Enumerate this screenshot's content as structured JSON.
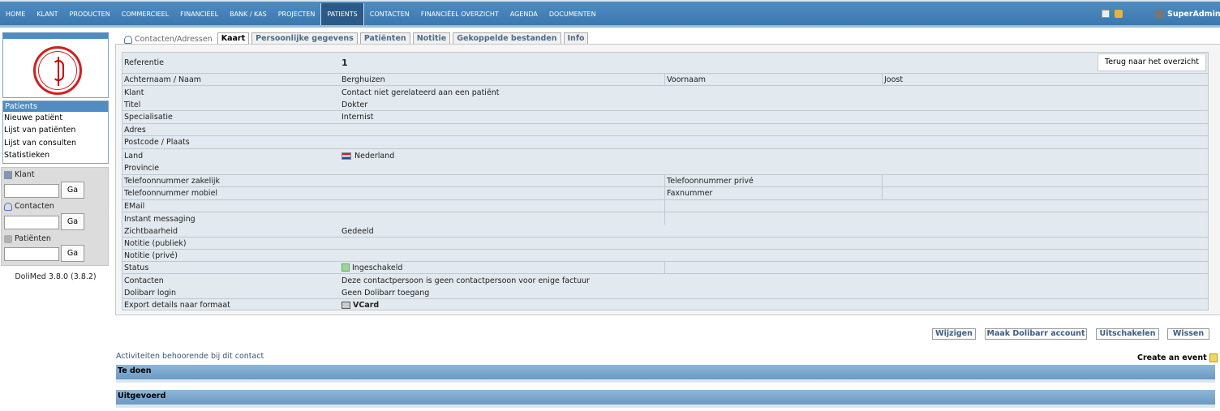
{
  "nav": {
    "items": [
      "HOME",
      "KLANT",
      "PRODUCTEN",
      "COMMERCIEEL",
      "FINANCIEEL",
      "BANK / KAS",
      "PROJECTEN",
      "PATIENTS",
      "CONTACTEN",
      "FINANCIËEL OVERZICHT",
      "AGENDA",
      "DOCUMENTEN"
    ],
    "active": "PATIENTS",
    "user": "SuperAdmin",
    "icons": [
      "print-icon",
      "lock-icon",
      "user-icon"
    ]
  },
  "sidebar": {
    "menu_title": "Patients",
    "links": [
      "Nieuwe patiënt",
      "Lijst van patiënten",
      "Lijst van consulten",
      "Statistieken"
    ],
    "search": [
      {
        "label": "Klant",
        "button": "Ga",
        "icon": "company-icon"
      },
      {
        "label": "Contacten",
        "button": "Ga",
        "icon": "contact-icon"
      },
      {
        "label": "Patiënten",
        "button": "Ga",
        "icon": "patient-icon"
      }
    ],
    "version": "DoliMed 3.8.0 (3.8.2)"
  },
  "tabs": {
    "first": "Contacten/Adressen",
    "items": [
      "Kaart",
      "Persoonlijke gegevens",
      "Patiënten",
      "Notitie",
      "Gekoppelde bestanden",
      "Info"
    ],
    "active": "Kaart"
  },
  "card": {
    "back_button": "Terug naar het overzicht",
    "referentie_label": "Referentie",
    "referentie_value": "1",
    "name_label": "Achternaam / Naam",
    "name_value": "Berghuizen",
    "firstname_label": "Voornaam",
    "firstname_value": "Joost",
    "klant_label": "Klant",
    "klant_value": "Contact niet gerelateerd aan een patiënt",
    "titel_label": "Titel",
    "titel_value": "Dokter",
    "spec_label": "Specialisatie",
    "spec_value": "Internist",
    "adres_label": "Adres",
    "postcode_label": "Postcode / Plaats",
    "land_label": "Land",
    "land_value": "Nederland",
    "provincie_label": "Provincie",
    "tel_work_label": "Telefoonnummer zakelijk",
    "tel_priv_label": "Telefoonnummer privé",
    "tel_mobile_label": "Telefoonnummer mobiel",
    "fax_label": "Faxnummer",
    "email_label": "EMail",
    "im_label": "Instant messaging",
    "visibility_label": "Zichtbaarheid",
    "visibility_value": "Gedeeld",
    "note_public_label": "Notitie (publiek)",
    "note_private_label": "Notitie (privé)",
    "status_label": "Status",
    "status_value": "Ingeschakeld",
    "contacts_label": "Contacten",
    "contacts_value": "Deze contactpersoon is geen contactpersoon voor enige factuur",
    "login_label": "Dolibarr login",
    "login_value": "Geen Dolibarr toegang",
    "export_label": "Export details naar formaat",
    "export_value": "VCard"
  },
  "actions": [
    "Wijzigen",
    "Maak Dolibarr account",
    "Uitschakelen",
    "Wissen"
  ],
  "activities": {
    "title": "Activiteiten behoorende bij dit contact",
    "create_event": "Create an event",
    "todo": "Te doen",
    "done": "Uitgevoerd"
  }
}
